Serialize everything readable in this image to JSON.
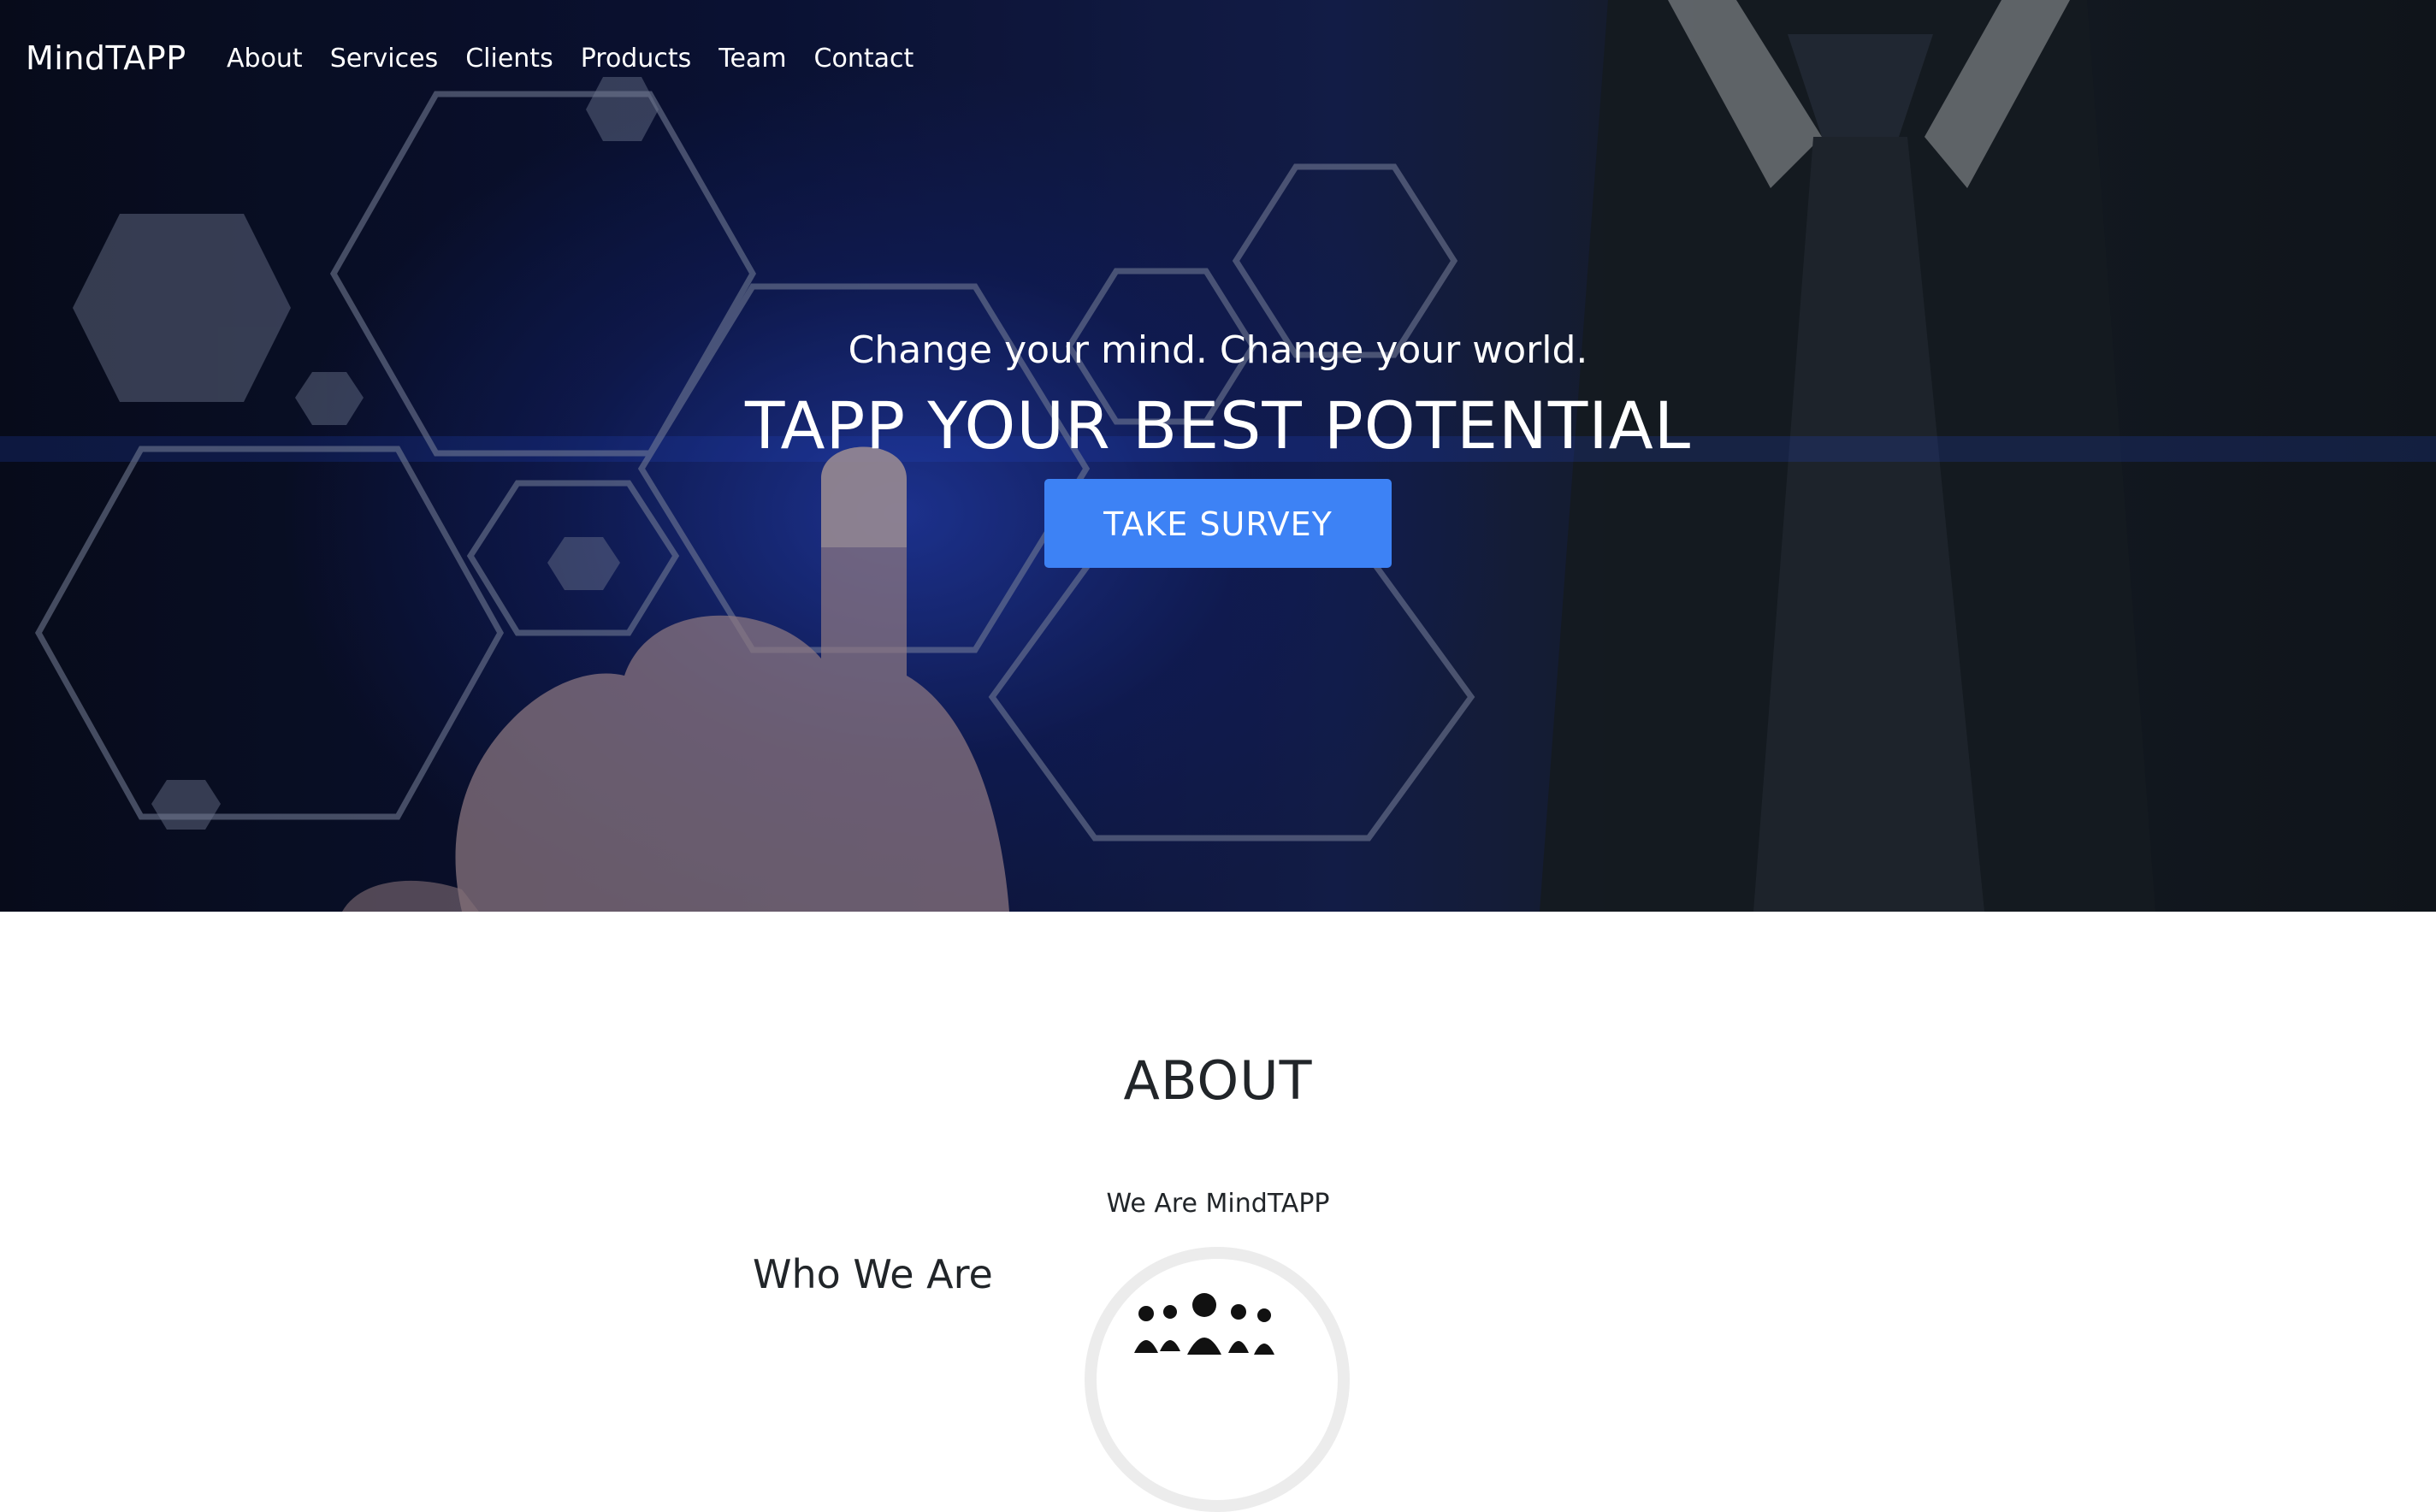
{
  "brand": "MindTAPP",
  "nav": {
    "items": [
      {
        "label": "About"
      },
      {
        "label": "Services"
      },
      {
        "label": "Clients"
      },
      {
        "label": "Products"
      },
      {
        "label": "Team"
      },
      {
        "label": "Contact"
      }
    ]
  },
  "hero": {
    "subtitle": "Change your mind. Change your world.",
    "title": "TAPP YOUR BEST POTENTIAL",
    "cta_label": "TAKE SURVEY",
    "cta_color": "#3d82f5"
  },
  "about": {
    "heading": "ABOUT",
    "tagline": "We Are MindTAPP",
    "who_heading": "Who We Are",
    "image_icon": "team-people-icon"
  }
}
